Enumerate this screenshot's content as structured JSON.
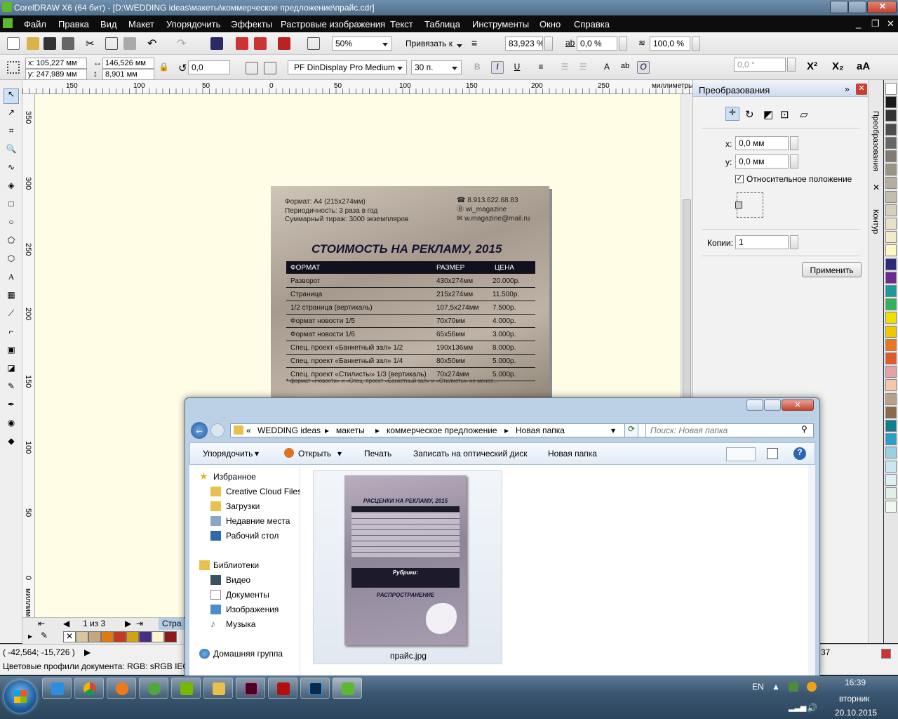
{
  "window": {
    "title": "CorelDRAW X6 (64 бит) - [D:\\WEDDING ideas\\макеты\\коммерческое предложение\\прайс.cdr]"
  },
  "menu": [
    "Файл",
    "Правка",
    "Вид",
    "Макет",
    "Упорядочить",
    "Эффекты",
    "Растровые изображения",
    "Текст",
    "Таблица",
    "Инструменты",
    "Окно",
    "Справка"
  ],
  "toolbar1": {
    "zoom": "50%",
    "snap": "Привязать к",
    "width_pct": "83,923 %",
    "skew": "0,0 %",
    "scale": "100,0 %"
  },
  "toolbar2": {
    "x": "x: 105,227 мм",
    "y": "y: 247,989 мм",
    "w": "146,526 мм",
    "h": "8,901 мм",
    "angle": "0,0",
    "font": "PF DinDisplay Pro Medium",
    "size": "30 п.",
    "rotation": "0,0 °"
  },
  "ruler_top": [
    "150",
    "100",
    "50",
    "0",
    "50",
    "100",
    "150",
    "200",
    "250",
    "миллиметры"
  ],
  "ruler_left": [
    "350",
    "300",
    "250",
    "200",
    "150",
    "100",
    "50",
    "0",
    "миллиметры"
  ],
  "doc": {
    "format": "Формат: А4 (215х274мм)",
    "periodicity": "Периодичность: 3 раза в год",
    "circulation": "Суммарный тираж: 3000 экземпляров",
    "phone": "8.913.622.68.83",
    "vk": "wi_magazine",
    "email": "w.magazine@mail.ru",
    "heading": "СТОИМОСТЬ НА РЕКЛАМУ, 2015",
    "headers": [
      "ФОРМАТ",
      "РАЗМЕР",
      "ЦЕНА"
    ],
    "rows": [
      [
        "Разворот",
        "430х274мм",
        "20.000р."
      ],
      [
        "Страница",
        "215х274мм",
        "11.500р."
      ],
      [
        "1/2 страница (вертикаль)",
        "107,5х274мм",
        "7.500р."
      ],
      [
        "Формат новости 1/5",
        "70х70мм",
        "4.000р."
      ],
      [
        "Формат новости 1/6",
        "65х56мм",
        "3.000р."
      ],
      [
        "Спец. проект «Банкетный зал» 1/2",
        "190х136мм",
        "8.000р."
      ],
      [
        "Спец. проект «Банкетный зал» 1/4",
        "80х50мм",
        "5.000р."
      ],
      [
        "Спец. проект «Стилисты» 1/3 (вертикаль)",
        "70х274мм",
        "5.000р."
      ]
    ],
    "footnote": "* формат «Новости» и «Спец. проект «Банкетный зал» и «Стилисты» не менее..."
  },
  "pagenav": {
    "counter": "1 из 3",
    "tab": "Стра"
  },
  "status": {
    "coords": "( -42,564; -15,726 )",
    "profile": "Цветовые профили документа: RGB: sRGB IEC6196",
    "right_num": "37"
  },
  "docker": {
    "title": "Преобразования",
    "x": "0,0 мм",
    "y": "0,0 мм",
    "relative": "Относительное положение",
    "copies_label": "Копии:",
    "copies": "1",
    "apply": "Применить",
    "tabs": [
      "Преобразования",
      "Контур"
    ]
  },
  "explorer": {
    "breadcrumb": [
      "WEDDING ideas",
      "макеты",
      "коммерческое предложение",
      "Новая папка"
    ],
    "search_placeholder": "Поиск: Новая папка",
    "commands": [
      "Упорядочить",
      "Открыть",
      "Печать",
      "Записать на оптический диск",
      "Новая папка"
    ],
    "nav": {
      "favorites": "Избранное",
      "fav_items": [
        "Creative Cloud Files",
        "Загрузки",
        "Недавние места",
        "Рабочий стол"
      ],
      "libraries": "Библиотеки",
      "lib_items": [
        "Видео",
        "Документы",
        "Изображения",
        "Музыка"
      ],
      "homegroup": "Домашняя группа"
    },
    "file": {
      "name": "прайс.jpg",
      "thumb_title": "РАСЦЕНКИ НА РЕКЛАМУ, 2015",
      "thumb_rubrics": "Рубрики:",
      "thumb_dist": "РАСПРОСТРАНЕНИЕ"
    }
  },
  "taskbar": {
    "lang": "EN",
    "time": "16:39",
    "day": "вторник",
    "date": "20.10.2015"
  },
  "colors": {
    "menubar": "#0d0d0d",
    "canvas": "#fffde6",
    "accent": "#3a6ea5"
  }
}
